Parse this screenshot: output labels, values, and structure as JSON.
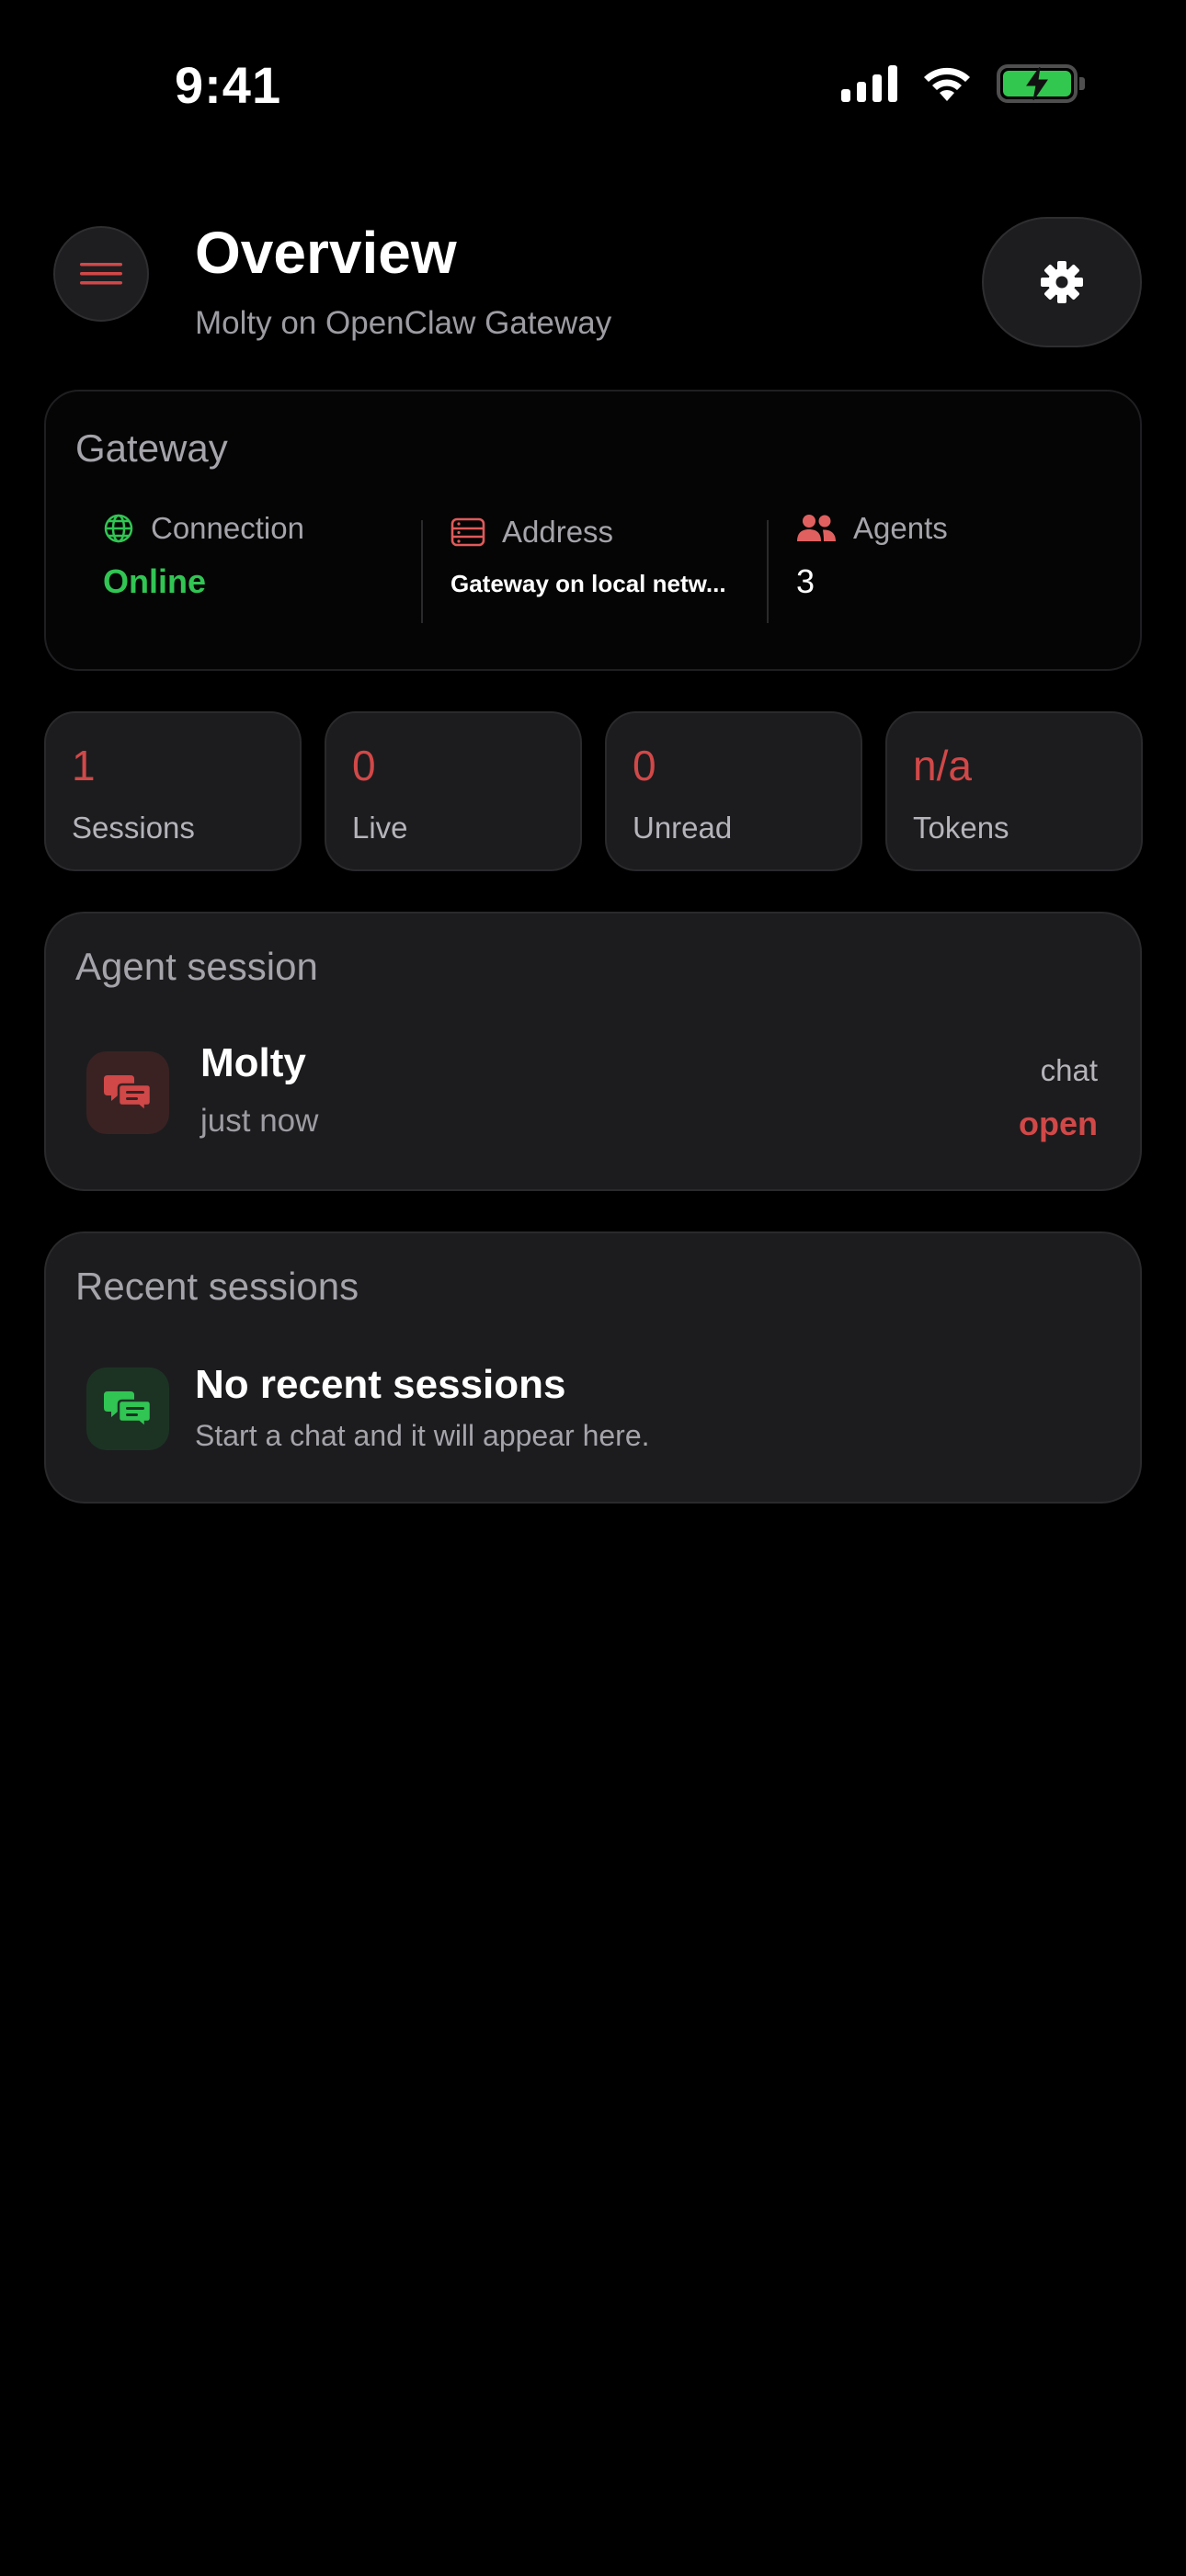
{
  "status_bar": {
    "time": "9:41"
  },
  "header": {
    "title": "Overview",
    "subtitle": "Molty on OpenClaw Gateway"
  },
  "gateway": {
    "title": "Gateway",
    "connection": {
      "label": "Connection",
      "value": "Online"
    },
    "address": {
      "label": "Address",
      "value": "Gateway on local netw..."
    },
    "agents": {
      "label": "Agents",
      "value": "3"
    }
  },
  "stats": [
    {
      "value": "1",
      "label": "Sessions"
    },
    {
      "value": "0",
      "label": "Live"
    },
    {
      "value": "0",
      "label": "Unread"
    },
    {
      "value": "n/a",
      "label": "Tokens"
    }
  ],
  "agent_session": {
    "title": "Agent session",
    "name": "Molty",
    "time": "just now",
    "kind": "chat",
    "action": "open"
  },
  "recent_sessions": {
    "title": "Recent sessions",
    "empty_title": "No recent sessions",
    "empty_hint": "Start a chat and it will appear here."
  },
  "colors": {
    "accent_red": "#d14848",
    "online_green": "#31c553",
    "battery_green": "#32c74e",
    "background": "#000000",
    "card": "#1c1c1e"
  },
  "icons": [
    "menu-icon",
    "gear-icon",
    "globe-icon",
    "server-icon",
    "people-icon",
    "chat-bubbles-icon"
  ]
}
